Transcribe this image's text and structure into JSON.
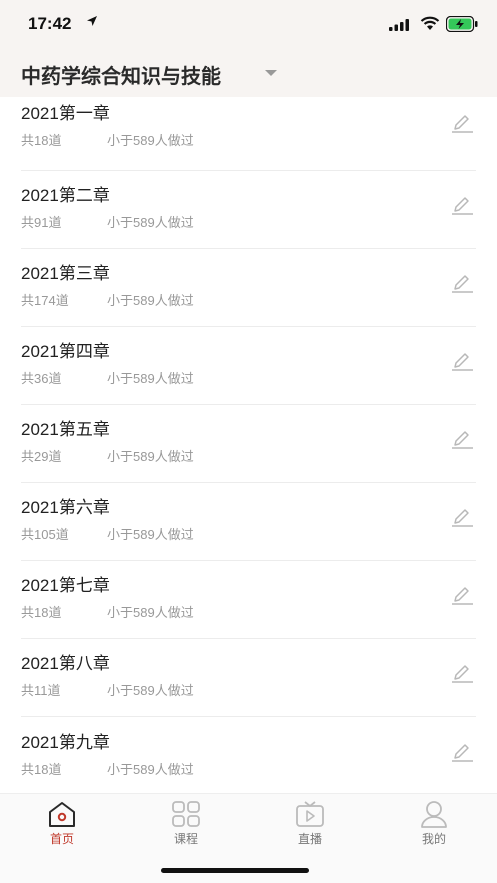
{
  "status": {
    "time": "17:42"
  },
  "header": {
    "title": "中药学综合知识与技能"
  },
  "chapters": [
    {
      "title": "2021第一章",
      "count": "共18道",
      "done": "小于589人做过"
    },
    {
      "title": "2021第二章",
      "count": "共91道",
      "done": "小于589人做过"
    },
    {
      "title": "2021第三章",
      "count": "共174道",
      "done": "小于589人做过"
    },
    {
      "title": "2021第四章",
      "count": "共36道",
      "done": "小于589人做过"
    },
    {
      "title": "2021第五章",
      "count": "共29道",
      "done": "小于589人做过"
    },
    {
      "title": "2021第六章",
      "count": "共105道",
      "done": "小于589人做过"
    },
    {
      "title": "2021第七章",
      "count": "共18道",
      "done": "小于589人做过"
    },
    {
      "title": "2021第八章",
      "count": "共11道",
      "done": "小于589人做过"
    },
    {
      "title": "2021第九章",
      "count": "共18道",
      "done": "小于589人做过"
    }
  ],
  "tabbar": {
    "home": "首页",
    "courses": "课程",
    "live": "直播",
    "mine": "我的",
    "active_color": "#c0392b"
  }
}
